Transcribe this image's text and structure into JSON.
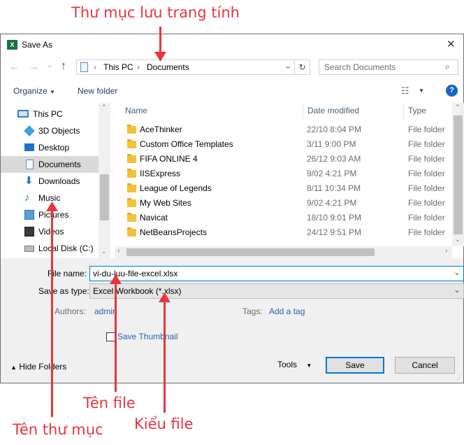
{
  "annotations": {
    "top": "Thư mục lưu trang tính",
    "file_name": "Tên file",
    "folder_name": "Tên thư mục",
    "file_type": "Kiểu file"
  },
  "window": {
    "title": "Save As",
    "app_icon": "excel-icon",
    "close_glyph": "✕"
  },
  "address_bar": {
    "path": [
      "This PC",
      "Documents"
    ],
    "separator": "›",
    "search_placeholder": "Search Documents"
  },
  "toolbar": {
    "organize_label": "Organize",
    "new_folder_label": "New folder",
    "help_glyph": "?"
  },
  "nav_pane": {
    "items": [
      {
        "label": "This PC",
        "icon": "computer-icon"
      },
      {
        "label": "3D Objects",
        "icon": "cube-icon"
      },
      {
        "label": "Desktop",
        "icon": "desktop-icon"
      },
      {
        "label": "Documents",
        "icon": "document-icon",
        "selected": true
      },
      {
        "label": "Downloads",
        "icon": "download-icon"
      },
      {
        "label": "Music",
        "icon": "music-icon"
      },
      {
        "label": "Pictures",
        "icon": "pictures-icon"
      },
      {
        "label": "Videos",
        "icon": "videos-icon"
      },
      {
        "label": "Local Disk (C:)",
        "icon": "disk-icon"
      }
    ]
  },
  "file_list": {
    "columns": [
      "Name",
      "Date modified",
      "Type"
    ],
    "rows": [
      {
        "name": "AceThinker",
        "date": "22/10 8:04 PM",
        "type": "File folder"
      },
      {
        "name": "Custom Office Templates",
        "date": "3/11 9:00 PM",
        "type": "File folder"
      },
      {
        "name": "FIFA ONLINE 4",
        "date": "26/12 9:03 AM",
        "type": "File folder"
      },
      {
        "name": "IISExpress",
        "date": "9/02 4:21 PM",
        "type": "File folder"
      },
      {
        "name": "League of Legends",
        "date": "8/11 10:34 PM",
        "type": "File folder"
      },
      {
        "name": "My Web Sites",
        "date": "9/02 4:21 PM",
        "type": "File folder"
      },
      {
        "name": "Navicat",
        "date": "18/10 9:01 PM",
        "type": "File folder"
      },
      {
        "name": "NetBeansProjects",
        "date": "24/12 9:51 PM",
        "type": "File folder"
      }
    ]
  },
  "form": {
    "file_name_label": "File name:",
    "file_name_value": "vi-du-luu-file-excel.xlsx",
    "save_type_label": "Save as type:",
    "save_type_value": "Excel Workbook (*.xlsx)",
    "authors_label": "Authors:",
    "authors_value": "admin",
    "tags_label": "Tags:",
    "tags_value": "Add a tag",
    "thumbnail_label": "Save Thumbnail",
    "thumbnail_checked": false
  },
  "footer": {
    "hide_folders_label": "Hide Folders",
    "tools_label": "Tools",
    "save_label": "Save",
    "cancel_label": "Cancel"
  },
  "colors": {
    "annotation": "#e8353e",
    "selection": "#d9d9d9",
    "focus": "#0078d7",
    "link": "#2a5fae"
  }
}
